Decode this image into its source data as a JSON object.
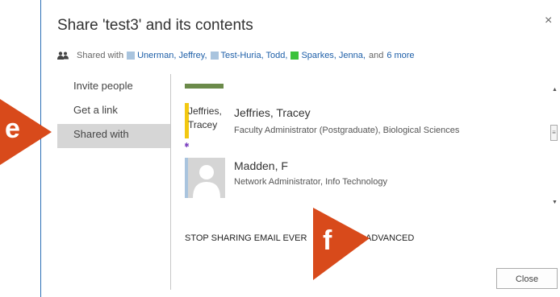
{
  "dialog": {
    "title": "Share 'test3' and its contents",
    "close_glyph": "×"
  },
  "shared_with": {
    "prefix": "Shared with",
    "people": [
      {
        "name": "Unerman, Jeffrey,",
        "color": "#a9c4de"
      },
      {
        "name": "Test-Huria, Todd,",
        "color": "#a9c4de"
      },
      {
        "name": "Sparkes, Jenna,",
        "color": "#3cc23c"
      }
    ],
    "suffix": "and",
    "more": "6 more"
  },
  "nav": {
    "items": [
      {
        "label": "Invite people",
        "selected": false
      },
      {
        "label": "Get a link",
        "selected": false
      },
      {
        "label": "Shared with",
        "selected": true
      }
    ]
  },
  "people_list": [
    {
      "avatar_text": "Jeffries, Tracey",
      "name": "Jeffries, Tracey",
      "title": "Faculty Administrator (Postgraduate), Biological Sciences"
    },
    {
      "avatar_text": "",
      "name": "Madden, F",
      "title": "Network Administrator, Info Technology"
    }
  ],
  "footer": {
    "stop_sharing": "STOP SHARING EMAIL EVER",
    "advanced": "ADVANCED",
    "close_button": "Close"
  },
  "callouts": {
    "e": "e",
    "f": "f",
    "color": "#d84a1b"
  },
  "colors": {
    "accent_border": "#2b6fb6",
    "link": "#1e5fa8",
    "selected_nav": "#d6d6d6"
  },
  "icons": [
    "people-icon",
    "close-icon",
    "scroll-up-icon",
    "scroll-down-icon",
    "default-avatar-icon"
  ]
}
